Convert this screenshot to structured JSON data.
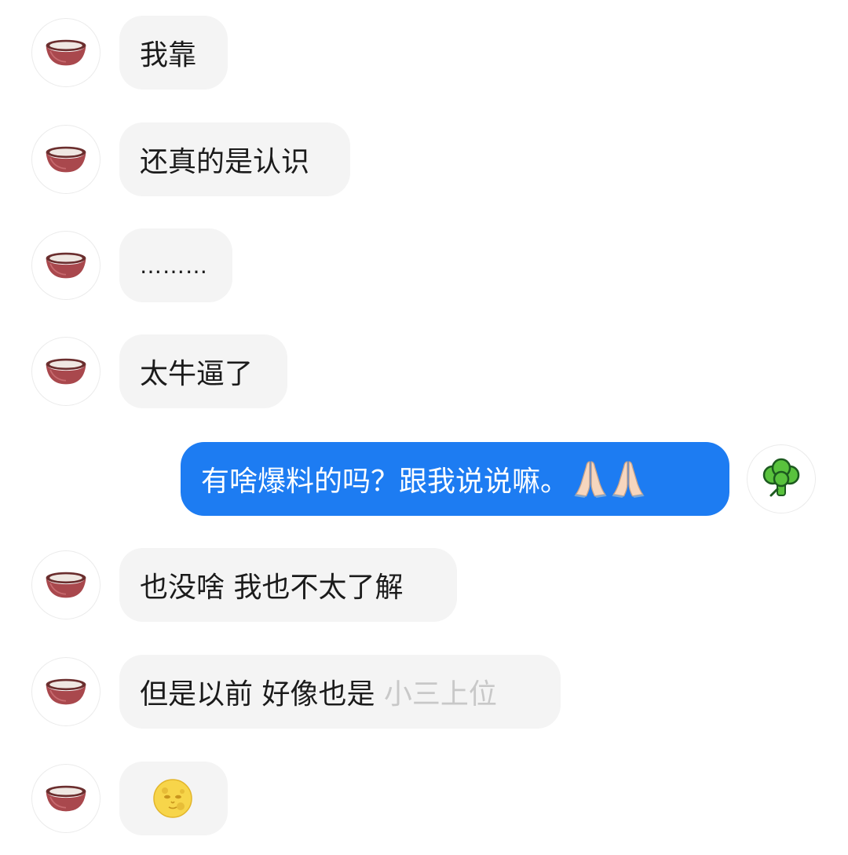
{
  "messages": [
    {
      "id": "m1",
      "side": "in",
      "text": "我靠"
    },
    {
      "id": "m2",
      "side": "in",
      "text": "还真的是认识"
    },
    {
      "id": "m3",
      "side": "in",
      "text": "………"
    },
    {
      "id": "m4",
      "side": "in",
      "text": "太牛逼了"
    },
    {
      "id": "m5",
      "side": "out",
      "text": "有啥爆料的吗？跟我说说嘛。",
      "emoji": "folded-hands-emoji x2"
    },
    {
      "id": "m6",
      "side": "in",
      "text": "也没啥 我也不太了解"
    },
    {
      "id": "m7",
      "side": "in",
      "text": "但是以前 好像也是 ",
      "faded_text": "小三上位"
    },
    {
      "id": "m8",
      "side": "in",
      "text": "",
      "emoji": "moon-face-emoji"
    }
  ],
  "avatars": {
    "contact": "bowl-icon",
    "self": "broccoli-icon"
  },
  "colors": {
    "incoming_bubble": "#f4f4f4",
    "outgoing_bubble": "#1d7cf2",
    "text": "#1b1b1b"
  }
}
